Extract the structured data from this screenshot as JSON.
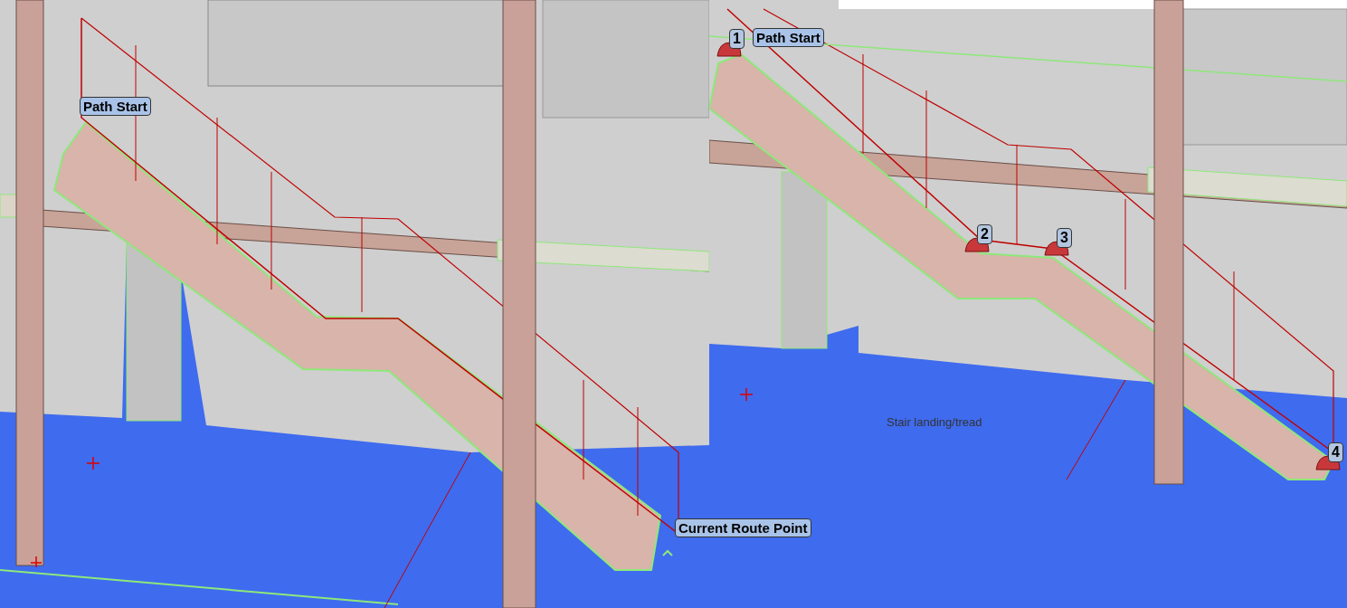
{
  "views": [
    {
      "labels": [
        {
          "text": "Path Start"
        },
        {
          "text": "Current Route Point"
        }
      ]
    },
    {
      "labels": [
        {
          "text": "Path Start"
        }
      ],
      "points": [
        {
          "number": "1"
        },
        {
          "number": "2"
        },
        {
          "number": "3"
        },
        {
          "number": "4"
        }
      ],
      "caption": "Stair landing/tread"
    }
  ]
}
